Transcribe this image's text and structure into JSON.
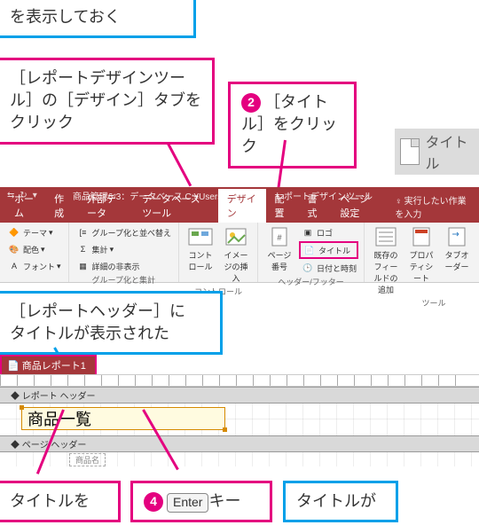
{
  "callouts": {
    "top_blue": "を表示しておく",
    "step1": "［レポートデザインツール］の［デザイン］タブをクリック",
    "step2_num": "2",
    "step2": "［タイトル］をクリック",
    "mid_blue_l1": "［レポートヘッダー］に",
    "mid_blue_l2": "タイトルが表示された",
    "step3": "タイトルを",
    "step4_num": "4",
    "step4_key": "Enter",
    "step4_tail": "キー",
    "bottom_blue": "タイトルが"
  },
  "big_button": {
    "label": "タイトル"
  },
  "titlebar": {
    "qat": [
      "⇆",
      "↻",
      "▾"
    ],
    "window_title": "商品管理6-3：データベース C:¥Users",
    "context_title": "レポートデザインツール"
  },
  "tabs": {
    "home": "ホーム",
    "create": "作成",
    "external": "外部データ",
    "dbtools": "データベースツール",
    "design": "デザイン",
    "arrange": "配置",
    "format": "書式",
    "pagesetup": "ページ設定",
    "tellme": "実行したい作業を入力"
  },
  "ribbon": {
    "themes": {
      "themes": "テーマ",
      "colors": "配色",
      "fonts": "フォント"
    },
    "group_totals": {
      "group_sort": "グループ化と並べ替え",
      "totals": "集計",
      "hide_details": "詳細の非表示",
      "label": "グループ化と集計"
    },
    "controls": {
      "controls": "コントロール",
      "image": "イメージの挿入",
      "label": "コントロール"
    },
    "headerfooter": {
      "pagenum": "ページ番号",
      "logo": "ロゴ",
      "title": "タイトル",
      "datetime": "日付と時刻",
      "label": "ヘッダー/フッター"
    },
    "tools": {
      "addfields": "既存のフィールドの追加",
      "propsheet": "プロパティシート",
      "taborder": "タブオーダー",
      "label": "ツール"
    }
  },
  "design": {
    "doc_tab": "商品レポート1",
    "section_report_header": "レポート ヘッダー",
    "section_page_header": "ページ ヘッダー",
    "title_value": "商品一覧",
    "detail_label": "商品名"
  }
}
